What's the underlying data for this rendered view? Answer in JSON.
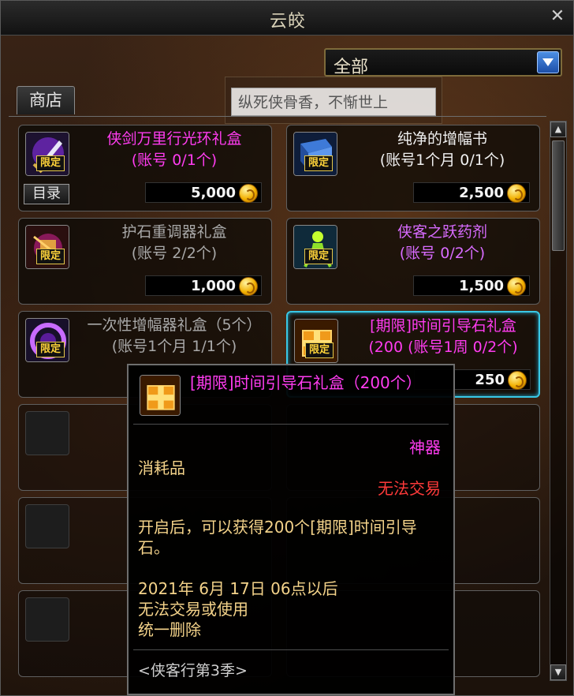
{
  "window": {
    "title": "云皎",
    "close_glyph": "✕"
  },
  "filter": {
    "selected": "全部"
  },
  "tabs": [
    {
      "label": "商店"
    }
  ],
  "search": {
    "text": "纵死侠骨香，不惭世上"
  },
  "catalog_label": "目录",
  "items": [
    {
      "name": "侠剑万里行光环礼盒",
      "limit": "(账号 0/1个)",
      "price": "5,000",
      "badge": "限定",
      "color": "#ff3cf0"
    },
    {
      "name": "纯净的增幅书",
      "limit": "(账号1个月 0/1个)",
      "price": "2,500",
      "badge": "限定",
      "color": "#f0f0f0"
    },
    {
      "name": "护石重调器礼盒",
      "limit": "(账号 2/2个)",
      "price": "1,000",
      "badge": "限定",
      "color": "#a8a8a8"
    },
    {
      "name": "侠客之跃药剂",
      "limit": "(账号 0/2个)",
      "price": "1,500",
      "badge": "限定",
      "color": "#d86bff"
    },
    {
      "name": "一次性增幅器礼盒（5个）(账号1个月 1/1个)",
      "price": "",
      "badge": "限定",
      "color": "#a8a8a8"
    },
    {
      "name": "[期限]时间引导石礼盒",
      "limit": "(200 (账号1周 0/2个)",
      "price": "250",
      "badge": "限定",
      "color": "#ff3cf0"
    }
  ],
  "tooltip": {
    "name": "[期限]时间引导石礼盒（200个）",
    "rarity": "神器",
    "type": "消耗品",
    "trade": "无法交易",
    "description": "开启后，可以获得200个[期限]时间引导石。",
    "expire_line1": "2021年 6月 17日 06点以后",
    "expire_line2": "无法交易或使用",
    "expire_line3": "统一删除",
    "set": "<侠客行第3季>"
  },
  "colors": {
    "legendary": "#ff3cf0",
    "trade_lock": "#ff3a3a",
    "desc": "#f4d38a",
    "selected_border": "#39c8e6"
  },
  "icons": [
    "close-icon",
    "dropdown-arrow-icon",
    "coin-icon",
    "scroll-up-icon",
    "scroll-down-icon"
  ]
}
